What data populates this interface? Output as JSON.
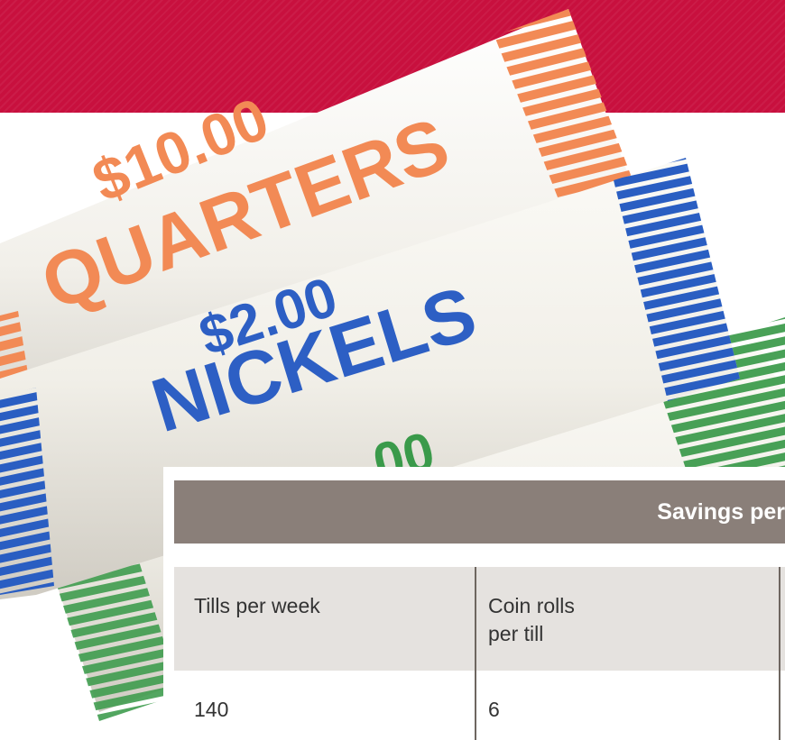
{
  "photo": {
    "rolls": [
      {
        "amount": "$10.00",
        "coin": "QUARTERS",
        "color": "#f07a4a"
      },
      {
        "amount": "$2.00",
        "coin": "NICKELS",
        "color": "#2d5fc4"
      },
      {
        "amount": "00",
        "coin": "",
        "color": "#3a9a4a"
      }
    ]
  },
  "banner": {
    "color": "#c8103e"
  },
  "table": {
    "title": "Savings per",
    "headers": [
      "Tills per week",
      "Coin rolls\nper till"
    ],
    "rows": [
      [
        "140",
        "6"
      ]
    ]
  }
}
